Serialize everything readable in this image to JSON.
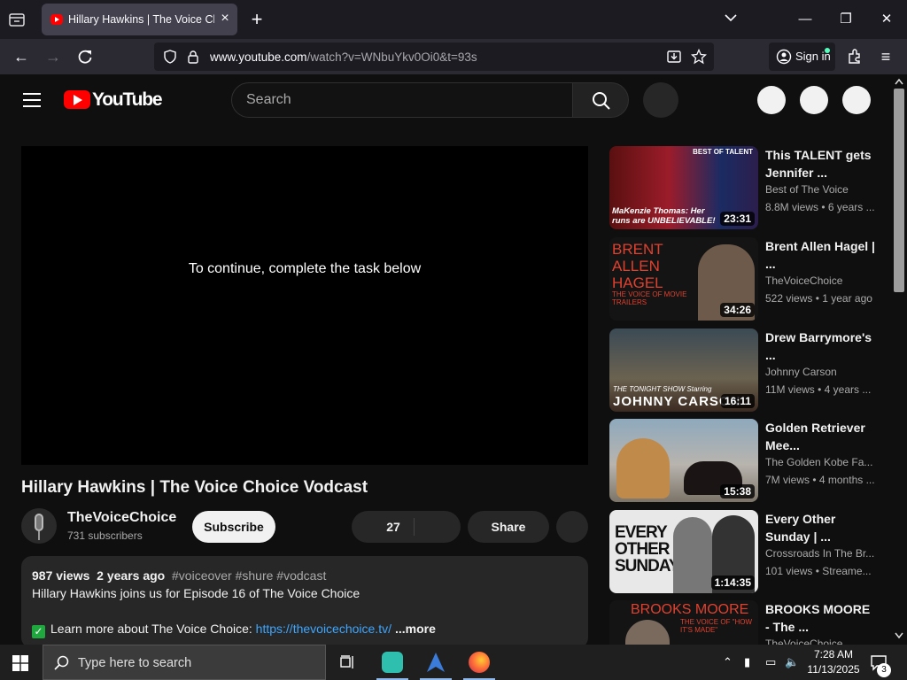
{
  "browser": {
    "tab_title": "Hillary Hawkins | The Voice Choice Vodcast - YouTube",
    "url_host": "www.youtube.com",
    "url_path": "/watch?v=WNbuYkv0Oi0&t=93s",
    "sign_in_label": "Sign in"
  },
  "youtube": {
    "logo_text": "YouTube",
    "search_placeholder": "Search",
    "player_message": "To continue, complete the task below",
    "video_title": "Hillary Hawkins | The Voice Choice Vodcast",
    "channel_name": "TheVoiceChoice",
    "channel_subs": "731 subscribers",
    "subscribe_label": "Subscribe",
    "like_count": "27",
    "share_label": "Share",
    "description": {
      "views": "987 views",
      "age": "2 years ago",
      "tags": "#voiceover #shure #vodcast",
      "line2": "Hillary Hawkins joins us for Episode 16 of The Voice Choice",
      "line3_prefix": "Learn more about The Voice Choice:",
      "link": "https://thevoicechoice.tv/",
      "more_label": "...more"
    },
    "recommendations": [
      {
        "title": "This TALENT gets Jennifer ...",
        "channel": "Best of The Voice",
        "meta": "8.8M views • 6 years ...",
        "duration": "23:31",
        "thumb_caption": "MaKenzie Thomas: Her runs are UNBELIEVABLE!",
        "thumb_badge": "BEST OF TALENT"
      },
      {
        "title": "Brent Allen Hagel | ...",
        "channel": "TheVoiceChoice",
        "meta": "522 views • 1 year ago",
        "duration": "34:26",
        "thumb_caption": "BRENT ALLEN HAGEL",
        "thumb_sub": "THE VOICE OF MOVIE TRAILERS"
      },
      {
        "title": "Drew Barrymore's ...",
        "channel": "Johnny Carson",
        "meta": "11M views • 4 years ...",
        "duration": "16:11",
        "thumb_caption": "JOHNNY CARSON",
        "thumb_sub": "THE TONIGHT SHOW Starring"
      },
      {
        "title": "Golden Retriever Mee...",
        "channel": "The Golden Kobe Fa...",
        "meta": "7M views • 4 months ...",
        "duration": "15:38"
      },
      {
        "title": "Every Other Sunday | ...",
        "channel": "Crossroads In The Br...",
        "meta": "101 views • Streame...",
        "duration": "1:14:35",
        "thumb_caption": "EVERY OTHER SUNDAY"
      },
      {
        "title": "BROOKS MOORE - The ...",
        "channel": "TheVoiceChoice",
        "meta": "",
        "duration": "",
        "thumb_caption": "BROOKS MOORE",
        "thumb_sub": "THE VOICE OF \"HOW IT'S MADE\""
      }
    ]
  },
  "taskbar": {
    "search_placeholder": "Type here to search",
    "time": "7:28 AM",
    "date": "11/13/2025",
    "notification_count": "3"
  },
  "colors": {
    "accent_red": "#ff0000",
    "link_blue": "#3ea6ff",
    "background": "#0f0f0f"
  }
}
